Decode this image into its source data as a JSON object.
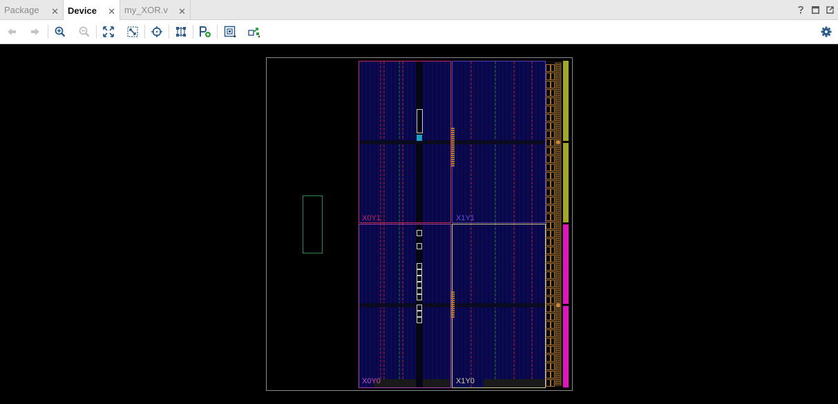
{
  "tabs": [
    {
      "label": "Package",
      "active": false
    },
    {
      "label": "Device",
      "active": true
    },
    {
      "label": "my_XOR.v",
      "active": false
    }
  ],
  "tabbar_icons": [
    "help-icon",
    "maximize-icon",
    "float-window-icon"
  ],
  "toolbar": {
    "buttons": [
      {
        "name": "back-button",
        "icon": "arrow-left-icon",
        "enabled": false
      },
      {
        "name": "forward-button",
        "icon": "arrow-right-icon",
        "enabled": false
      },
      {
        "name": "zoom-in-button",
        "icon": "zoom-in-icon",
        "enabled": true
      },
      {
        "name": "zoom-out-button",
        "icon": "zoom-out-icon",
        "enabled": false
      },
      {
        "name": "zoom-fit-button",
        "icon": "fit-view-icon",
        "enabled": true
      },
      {
        "name": "zoom-selected-button",
        "icon": "zoom-selection-icon",
        "enabled": true
      },
      {
        "name": "auto-fit-selection-button",
        "icon": "crosshair-icon",
        "enabled": true
      },
      {
        "name": "routing-resources-button",
        "icon": "routing-icon",
        "enabled": true
      },
      {
        "name": "create-pblock-button",
        "icon": "pblock-add-icon",
        "enabled": true
      },
      {
        "name": "site-view-button",
        "icon": "site-icon",
        "enabled": true
      },
      {
        "name": "cell-view-button",
        "icon": "cell-icon",
        "enabled": true
      }
    ],
    "settings_icon": "gear-icon"
  },
  "device": {
    "clock_regions": [
      {
        "label": "X0Y1",
        "color": "#c02b63"
      },
      {
        "label": "X1Y1",
        "color": "#5a3fb5"
      },
      {
        "label": "X0Y0",
        "color": "#b43fb5"
      },
      {
        "label": "X1Y0",
        "color": "#cfc99a"
      }
    ],
    "colors": {
      "background": "#000000",
      "device_outline": "#8a8a8a",
      "fabric": "#07074a",
      "bram_column": "#b0242a",
      "dsp_column": "#1f7a2a",
      "io_bank_top": "#a3a82a",
      "io_bank_bottom": "#e015c0",
      "io_tiles": "#c88a3a",
      "pblock": "#2f8a4f",
      "cell_highlight": "#19a0c8"
    }
  }
}
